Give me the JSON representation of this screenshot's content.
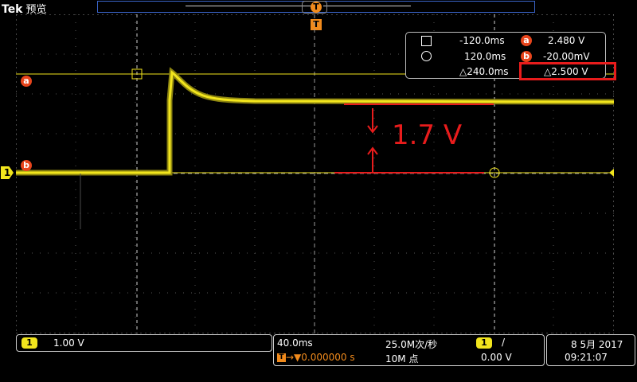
{
  "brand": {
    "name": "Tek",
    "mode": "预览"
  },
  "markers": {
    "a": "a",
    "b": "b",
    "ch1": "1",
    "trigger": "T"
  },
  "cursor_readout": {
    "t1": "-120.0ms",
    "t2": "120.0ms",
    "dt": "△240.0ms",
    "va": "2.480 V",
    "vb": "-20.00mV",
    "dv": "△2.500 V",
    "label_a": "a",
    "label_b": "b"
  },
  "annotation": {
    "text": "1.7 V"
  },
  "bottom": {
    "ch1_scale": "1.00 V",
    "ch1_badge": "1",
    "timebase": "40.0ms",
    "trigger_pos": "0.000000 s",
    "sample_rate": "25.0M次/秒",
    "record_length": "10M 点",
    "trig_source": "1",
    "trig_slope": "/",
    "trig_level": "0.00 V",
    "date": "8 5月 2017",
    "time": "09:21:07"
  },
  "colors": {
    "trace": "#f2e51d",
    "marker": "#e8451c",
    "annotation": "#e81c1c",
    "accent_blue": "#3a64c8"
  }
}
